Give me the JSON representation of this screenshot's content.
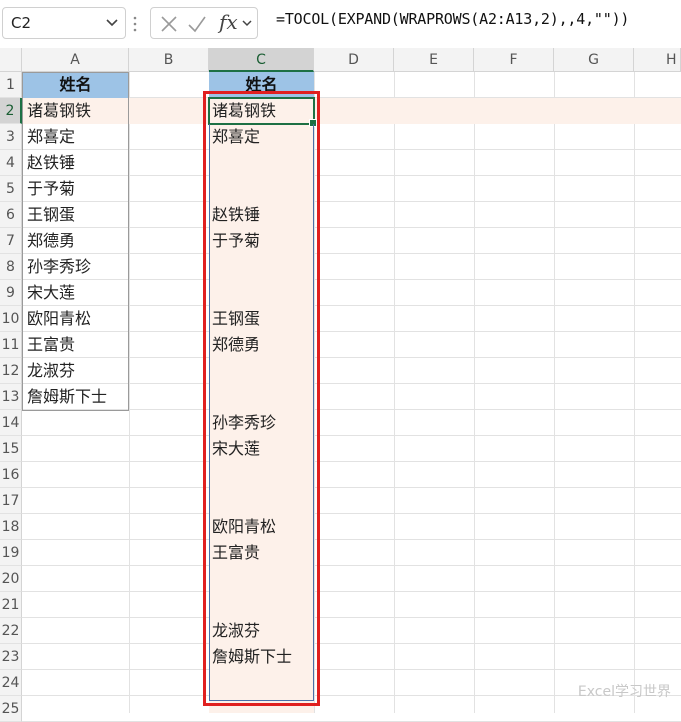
{
  "formula_bar": {
    "name_box": "C2",
    "fx_label": "fx",
    "formula": "=TOCOL(EXPAND(WRAPROWS(A2:A13,2),,4,\"\"))"
  },
  "columns": [
    "A",
    "B",
    "C",
    "D",
    "E",
    "F",
    "G",
    "H"
  ],
  "rows": [
    "1",
    "2",
    "3",
    "4",
    "5",
    "6",
    "7",
    "8",
    "9",
    "10",
    "11",
    "12",
    "13",
    "14",
    "15",
    "16",
    "17",
    "18",
    "19",
    "20",
    "21",
    "22",
    "23",
    "24",
    "25"
  ],
  "col_a": {
    "header": "姓名",
    "values": [
      "诸葛钢铁",
      "郑喜定",
      "赵铁锤",
      "于予菊",
      "王钢蛋",
      "郑德勇",
      "孙李秀珍",
      "宋大莲",
      "欧阳青松",
      "王富贵",
      "龙淑芬",
      "詹姆斯下士"
    ]
  },
  "col_c": {
    "header": "姓名",
    "values": [
      "诸葛钢铁",
      "郑喜定",
      "",
      "",
      "赵铁锤",
      "于予菊",
      "",
      "",
      "王钢蛋",
      "郑德勇",
      "",
      "",
      "孙李秀珍",
      "宋大莲",
      "",
      "",
      "欧阳青松",
      "王富贵",
      "",
      "",
      "龙淑芬",
      "詹姆斯下士",
      "",
      ""
    ]
  },
  "watermark": "Excel学习世界",
  "colors": {
    "header_fill": "#9dc3e6",
    "highlight_fill": "#fdf1ea",
    "selection_green": "#1d7044",
    "red_box": "#e02020"
  }
}
